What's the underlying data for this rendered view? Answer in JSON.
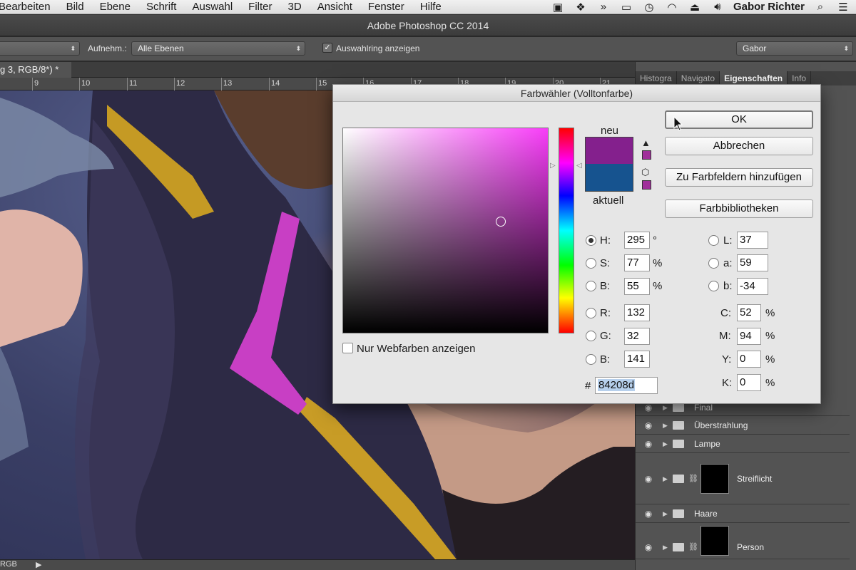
{
  "menubar": {
    "items": [
      "Bearbeiten",
      "Bild",
      "Ebene",
      "Schrift",
      "Auswahl",
      "Filter",
      "3D",
      "Ansicht",
      "Fenster",
      "Hilfe"
    ],
    "tray_icons": [
      "display-icon",
      "dropbox-icon",
      "arrows-icon",
      "airplay-icon",
      "time-machine-icon",
      "wifi-icon",
      "eject-icon",
      "volume-icon"
    ],
    "user": "Gabor Richter"
  },
  "app": {
    "title": "Adobe Photoshop CC 2014"
  },
  "options": {
    "sample_label": "Aufnehm.:",
    "sample_value": "Alle Ebenen",
    "show_ring_label": "Auswahlring anzeigen",
    "show_ring_checked": true,
    "workspace": "Gabor"
  },
  "document": {
    "tab": "g 3, RGB/8*) *",
    "ruler_ticks": [
      "9",
      "10",
      "11",
      "12",
      "13",
      "14",
      "15",
      "16",
      "17",
      "18",
      "19",
      "20",
      "21"
    ],
    "status": "RGB"
  },
  "panel": {
    "tabs": [
      "Histogra",
      "Navigato",
      "Eigenschaften",
      "Info"
    ],
    "active_tab": "Eigenschaften",
    "layers": [
      "Final",
      "Überstrahlung",
      "Lampe",
      "Streiflicht",
      "Haare",
      "Person"
    ]
  },
  "dialog": {
    "title": "Farbwähler (Volltonfarbe)",
    "new_label": "neu",
    "current_label": "aktuell",
    "new_color": "#84208d",
    "current_color": "#16538f",
    "buttons": {
      "ok": "OK",
      "cancel": "Abbrechen",
      "add_swatches": "Zu Farbfeldern hinzufügen",
      "libraries": "Farbbibliotheken"
    },
    "web_only_label": "Nur Webfarben anzeigen",
    "hsb": {
      "h_label": "H:",
      "h": "295",
      "h_unit": "°",
      "s_label": "S:",
      "s": "77",
      "s_unit": "%",
      "b_label": "B:",
      "b": "55",
      "b_unit": "%"
    },
    "rgb": {
      "r_label": "R:",
      "r": "132",
      "g_label": "G:",
      "g": "32",
      "b_label": "B:",
      "b": "141"
    },
    "lab": {
      "l_label": "L:",
      "l": "37",
      "a_label": "a:",
      "a": "59",
      "b_label": "b:",
      "b": "-34"
    },
    "cmyk": {
      "c_label": "C:",
      "c": "52",
      "m_label": "M:",
      "m": "94",
      "y_label": "Y:",
      "y": "0",
      "k_label": "K:",
      "k": "0",
      "unit": "%"
    },
    "hex_label": "#",
    "hex": "84208d",
    "selected_mode": "H"
  }
}
